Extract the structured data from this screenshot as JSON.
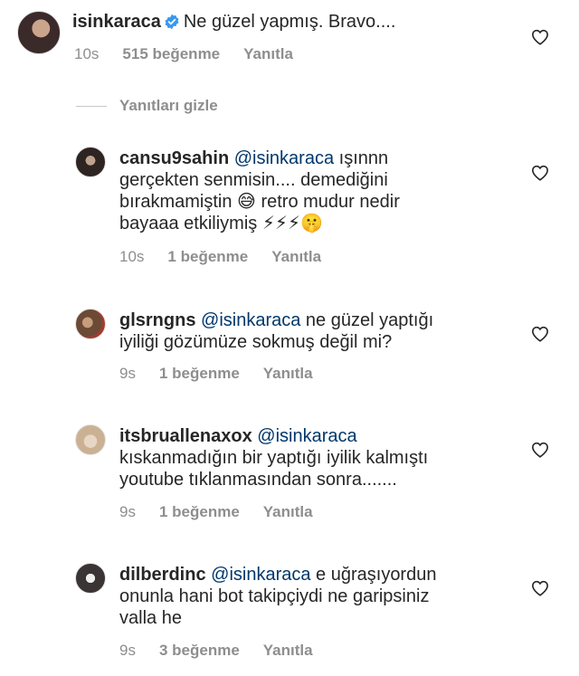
{
  "main_comment": {
    "username": "isinkaraca",
    "text": "Ne güzel yapmış. Bravo....",
    "time": "10s",
    "likes": "515 beğenme",
    "reply": "Yanıtla",
    "verified_icon": "verified-badge-icon"
  },
  "hide_replies": "Yanıtları gizle",
  "replies": [
    {
      "username": "cansu9sahin",
      "mention": "@isinkaraca",
      "line1": "ışınnn",
      "line2": "gerçekten senmisin.... demediğini",
      "line3a": "bırakmamiştin",
      "emoji1": "😅",
      "line3b": "retro mudur nedir",
      "line4": "bayaaa etkiliymiş",
      "emoji2": "⚡⚡⚡🤫",
      "time": "10s",
      "likes": "1 beğenme",
      "reply": "Yanıtla"
    },
    {
      "username": "glsrngns",
      "mention": "@isinkaraca",
      "line1": "ne güzel yaptığı",
      "line2": "iyiliği gözümüze sokmuş değil mi?",
      "time": "9s",
      "likes": "1 beğenme",
      "reply": "Yanıtla"
    },
    {
      "username": "itsbruallenaxox",
      "mention": "@isinkaraca",
      "line2": "kıskanmadığın bir yaptığı iyilik kalmıştı",
      "line3": "youtube tıklanmasından sonra.......",
      "time": "9s",
      "likes": "1 beğenme",
      "reply": "Yanıtla"
    },
    {
      "username": "dilberdinc",
      "mention": "@isinkaraca",
      "line1": "e uğraşıyordun",
      "line2": "onunla hani bot takipçiydi ne garipsiniz",
      "line3": "valla he",
      "time": "9s",
      "likes": "3 beğenme",
      "reply": "Yanıtla"
    }
  ],
  "icons": {
    "like": "heart-outline-icon"
  }
}
